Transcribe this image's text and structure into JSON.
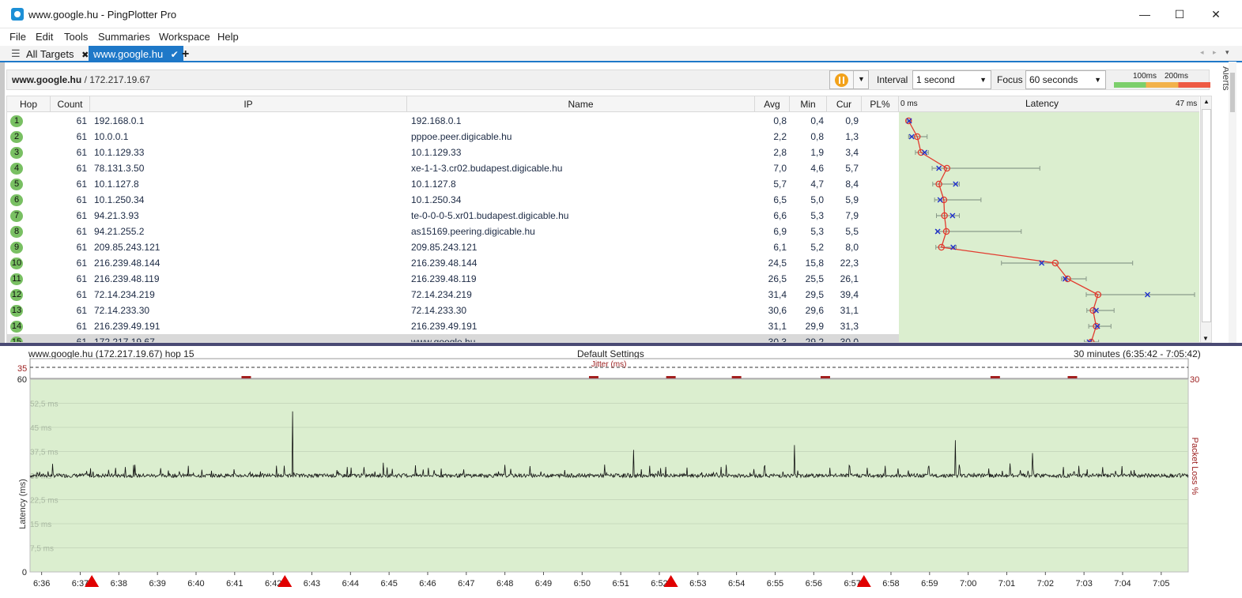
{
  "window": {
    "title": "www.google.hu - PingPlotter Pro",
    "minimize": "—",
    "maximize": "☐",
    "close": "✕"
  },
  "menu": [
    "File",
    "Edit",
    "Tools",
    "Summaries",
    "Workspace",
    "Help"
  ],
  "tabs": {
    "all_targets": "All Targets",
    "active": "www.google.hu",
    "add": "+"
  },
  "target": {
    "name": "www.google.hu",
    "address": "/ 172.217.19.67"
  },
  "controls": {
    "interval_label": "Interval",
    "interval_value": "1 second",
    "focus_label": "Focus",
    "focus_value": "60 seconds",
    "scale_100": "100ms",
    "scale_200": "200ms",
    "alerts": "Alerts"
  },
  "colors": {
    "accent": "#1e78c8",
    "hop_ok": "#79c063",
    "chart_bg": "#dbeecf",
    "trace": "#e23b2f",
    "packet_loss_marker": "#e00000",
    "pause": "#f2a21b"
  },
  "table": {
    "headers": [
      "Hop",
      "Count",
      "IP",
      "Name",
      "Avg",
      "Min",
      "Cur",
      "PL%"
    ],
    "latency_header": "Latency",
    "latency_min": "0 ms",
    "latency_max": "47 ms",
    "rows": [
      {
        "hop": "1",
        "count": "61",
        "ip": "192.168.0.1",
        "name": "192.168.0.1",
        "avg": "0,8",
        "min": "0,4",
        "cur": "0,9"
      },
      {
        "hop": "2",
        "count": "61",
        "ip": "10.0.0.1",
        "name": "pppoe.peer.digicable.hu",
        "avg": "2,2",
        "min": "0,8",
        "cur": "1,3"
      },
      {
        "hop": "3",
        "count": "61",
        "ip": "10.1.129.33",
        "name": "10.1.129.33",
        "avg": "2,8",
        "min": "1,9",
        "cur": "3,4"
      },
      {
        "hop": "4",
        "count": "61",
        "ip": "78.131.3.50",
        "name": "xe-1-1-3.cr02.budapest.digicable.hu",
        "avg": "7,0",
        "min": "4,6",
        "cur": "5,7"
      },
      {
        "hop": "5",
        "count": "61",
        "ip": "10.1.127.8",
        "name": "10.1.127.8",
        "avg": "5,7",
        "min": "4,7",
        "cur": "8,4"
      },
      {
        "hop": "6",
        "count": "61",
        "ip": "10.1.250.34",
        "name": "10.1.250.34",
        "avg": "6,5",
        "min": "5,0",
        "cur": "5,9"
      },
      {
        "hop": "7",
        "count": "61",
        "ip": "94.21.3.93",
        "name": "te-0-0-0-5.xr01.budapest.digicable.hu",
        "avg": "6,6",
        "min": "5,3",
        "cur": "7,9"
      },
      {
        "hop": "8",
        "count": "61",
        "ip": "94.21.255.2",
        "name": "as15169.peering.digicable.hu",
        "avg": "6,9",
        "min": "5,3",
        "cur": "5,5"
      },
      {
        "hop": "9",
        "count": "61",
        "ip": "209.85.243.121",
        "name": "209.85.243.121",
        "avg": "6,1",
        "min": "5,2",
        "cur": "8,0"
      },
      {
        "hop": "10",
        "count": "61",
        "ip": "216.239.48.144",
        "name": "216.239.48.144",
        "avg": "24,5",
        "min": "15,8",
        "cur": "22,3"
      },
      {
        "hop": "11",
        "count": "61",
        "ip": "216.239.48.119",
        "name": "216.239.48.119",
        "avg": "26,5",
        "min": "25,5",
        "cur": "26,1"
      },
      {
        "hop": "12",
        "count": "61",
        "ip": "72.14.234.219",
        "name": "72.14.234.219",
        "avg": "31,4",
        "min": "29,5",
        "cur": "39,4"
      },
      {
        "hop": "13",
        "count": "61",
        "ip": "72.14.233.30",
        "name": "72.14.233.30",
        "avg": "30,6",
        "min": "29,6",
        "cur": "31,1"
      },
      {
        "hop": "14",
        "count": "61",
        "ip": "216.239.49.191",
        "name": "216.239.49.191",
        "avg": "31,1",
        "min": "29,9",
        "cur": "31,3"
      },
      {
        "hop": "15",
        "count": "61",
        "ip": "172.217.19.67",
        "name": "www.google.hu",
        "avg": "30,3",
        "min": "29,2",
        "cur": "30,0"
      }
    ]
  },
  "timeline": {
    "target_label": "www.google.hu (172.217.19.67) hop 15",
    "settings_label": "Default Settings",
    "range_label": "30 minutes (6:35:42 - 7:05:42)",
    "jitter_label": "Jitter (ms)",
    "jitter_max": "35",
    "ylabel": "Latency (ms)",
    "y2label": "Packet Loss %",
    "y2_max": "30",
    "y_ticks": [
      {
        "v": 60,
        "label": "60"
      },
      {
        "v": 52.5,
        "label": "52,5 ms"
      },
      {
        "v": 45,
        "label": "45 ms"
      },
      {
        "v": 37.5,
        "label": "37,5 ms"
      },
      {
        "v": 30,
        "label": "30 ms"
      },
      {
        "v": 22.5,
        "label": "22,5 ms"
      },
      {
        "v": 15,
        "label": "15 ms"
      },
      {
        "v": 7.5,
        "label": "7,5 ms"
      },
      {
        "v": 0,
        "label": "0"
      }
    ],
    "x_ticks": [
      "6:36",
      "6:37",
      "6:38",
      "6:39",
      "6:40",
      "6:41",
      "6:42",
      "6:43",
      "6:44",
      "6:45",
      "6:46",
      "6:47",
      "6:48",
      "6:49",
      "6:50",
      "6:51",
      "6:52",
      "6:53",
      "6:54",
      "6:55",
      "6:56",
      "6:57",
      "6:58",
      "6:59",
      "7:00",
      "7:01",
      "7:02",
      "7:03",
      "7:04",
      "7:05"
    ],
    "loss_markers_min": [
      37.3,
      42.3,
      52.3,
      57.3
    ],
    "jitter_markers_min": [
      41.3,
      50.3,
      52.3,
      54.0,
      56.3,
      60.7,
      62.7
    ]
  },
  "chart_data": {
    "type": "line",
    "xlabel": "",
    "ylabel": "Latency (ms)",
    "ylim": [
      0,
      60
    ],
    "x_range": [
      "6:35:42",
      "7:05:42"
    ],
    "series": [
      {
        "baseline": 30,
        "x": [
          "6:36",
          "6:38",
          "6:40",
          "6:42",
          "6:42:30",
          "6:44",
          "6:46",
          "6:48",
          "6:50",
          "6:51:20",
          "6:53",
          "6:55",
          "6:55:30",
          "6:57",
          "6:59",
          "6:59:40",
          "7:01",
          "7:01:40",
          "7:03",
          "7:05"
        ],
        "values": [
          30.5,
          31.0,
          30.8,
          31.2,
          50.0,
          30.6,
          31.4,
          30.9,
          31.0,
          38.0,
          30.7,
          31.1,
          39.5,
          30.9,
          31.3,
          41.0,
          30.8,
          37.0,
          31.2,
          30.6
        ]
      }
    ],
    "hop_latency": {
      "avg": [
        0.8,
        2.2,
        2.8,
        7.0,
        5.7,
        6.5,
        6.6,
        6.9,
        6.1,
        24.5,
        26.5,
        31.4,
        30.6,
        31.1,
        30.3
      ],
      "min": [
        0.4,
        0.8,
        1.9,
        4.6,
        4.7,
        5.0,
        5.3,
        5.3,
        5.2,
        15.8,
        25.5,
        29.5,
        29.6,
        29.9,
        29.2
      ],
      "cur": [
        0.9,
        1.3,
        3.4,
        5.7,
        8.4,
        5.9,
        7.9,
        5.5,
        8.0,
        22.3,
        26.1,
        39.4,
        31.1,
        31.3,
        30.0
      ],
      "max": [
        1.2,
        3.8,
        4.0,
        22.0,
        9.0,
        12.5,
        9.0,
        19.0,
        8.5,
        37.0,
        29.5,
        47.0,
        34.0,
        33.5,
        31.5
      ],
      "xlim": [
        0,
        47
      ]
    }
  }
}
